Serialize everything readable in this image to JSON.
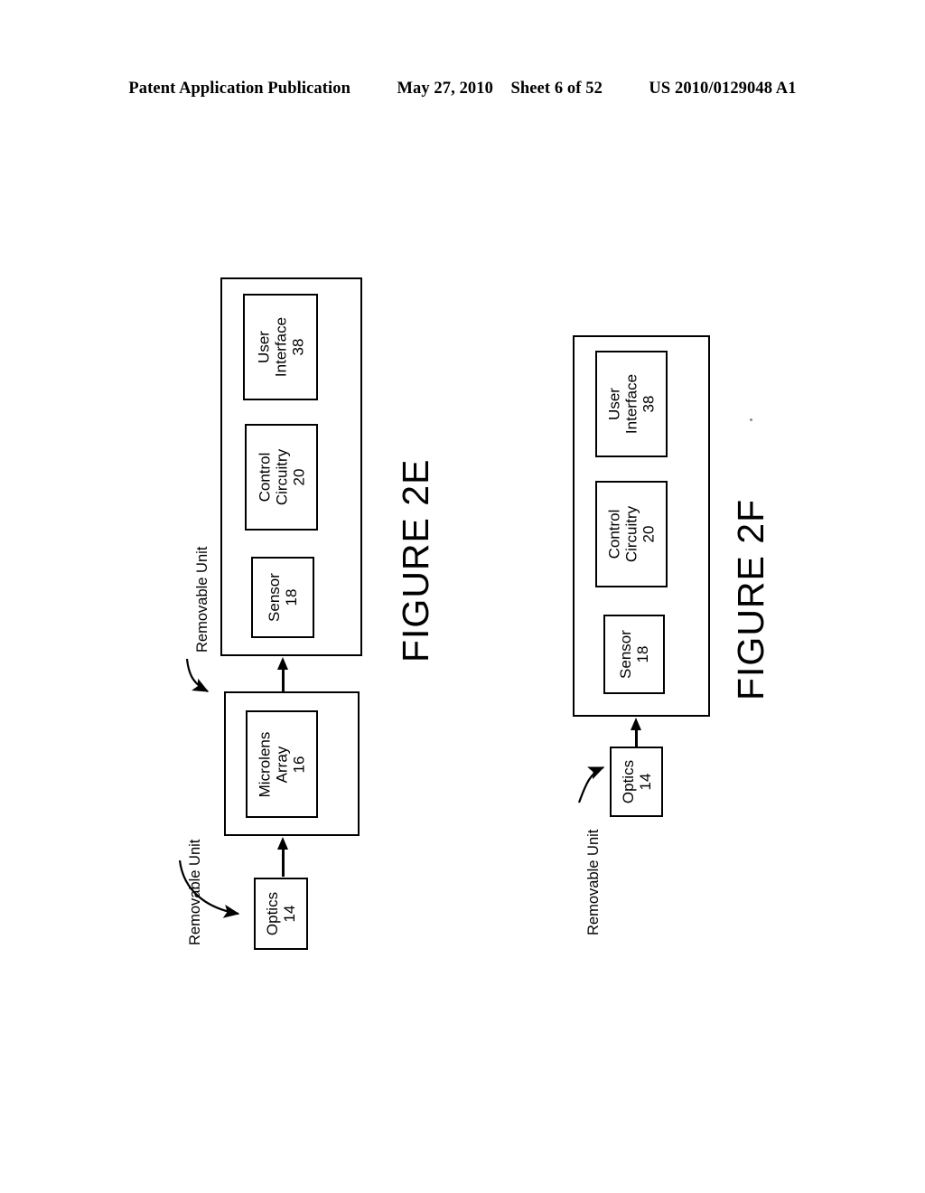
{
  "header": {
    "publication": "Patent Application Publication",
    "date": "May 27, 2010",
    "sheet": "Sheet 6 of 52",
    "doc_number": "US 2010/0129048 A1"
  },
  "figures": [
    {
      "id": "2E",
      "caption": "FIGURE 2E",
      "callouts": [
        {
          "text": "Removable Unit",
          "points_to": "main-unit-2e"
        },
        {
          "text": "Removable Unit",
          "points_to": "optics-14-2e"
        }
      ],
      "blocks": [
        {
          "id": "main-unit-2e",
          "kind": "container",
          "label": "",
          "number": ""
        },
        {
          "id": "user-interface-38-2e",
          "kind": "component",
          "label": "User\nInterface",
          "line1": "User",
          "line2": "Interface",
          "number": "38"
        },
        {
          "id": "control-circuitry-20-2e",
          "kind": "component",
          "line1": "Control",
          "line2": "Circuitry",
          "number": "20"
        },
        {
          "id": "sensor-18-2e",
          "kind": "component",
          "line1": "Sensor",
          "line2": "",
          "number": "18"
        },
        {
          "id": "microlens-unit-2e",
          "kind": "container",
          "label": "",
          "number": ""
        },
        {
          "id": "microlens-array-16-2e",
          "kind": "component",
          "line1": "Microlens",
          "line2": "Array",
          "number": "16"
        },
        {
          "id": "optics-14-2e",
          "kind": "component",
          "line1": "Optics",
          "line2": "",
          "number": "14"
        }
      ],
      "arrows": [
        {
          "from": "optics-14-2e",
          "to": "microlens-unit-2e"
        },
        {
          "from": "microlens-unit-2e",
          "to": "main-unit-2e"
        }
      ]
    },
    {
      "id": "2F",
      "caption": "FIGURE 2F",
      "callouts": [
        {
          "text": "Removable Unit",
          "points_to": "optics-14-2f"
        }
      ],
      "blocks": [
        {
          "id": "main-unit-2f",
          "kind": "container",
          "label": "",
          "number": ""
        },
        {
          "id": "user-interface-38-2f",
          "kind": "component",
          "line1": "User",
          "line2": "Interface",
          "number": "38"
        },
        {
          "id": "control-circuitry-20-2f",
          "kind": "component",
          "line1": "Control",
          "line2": "Circuitry",
          "number": "20"
        },
        {
          "id": "sensor-18-2f",
          "kind": "component",
          "line1": "Sensor",
          "line2": "",
          "number": "18"
        },
        {
          "id": "optics-14-2f",
          "kind": "component",
          "line1": "Optics",
          "line2": "",
          "number": "14"
        }
      ],
      "arrows": [
        {
          "from": "optics-14-2f",
          "to": "main-unit-2f"
        }
      ]
    }
  ],
  "labels": {
    "user_interface": "User",
    "user_interface_2": "Interface",
    "user_interface_num": "38",
    "control": "Control",
    "circuitry": "Circuitry",
    "control_num": "20",
    "sensor": "Sensor",
    "sensor_num": "18",
    "microlens": "Microlens",
    "array": "Array",
    "microlens_num": "16",
    "optics": "Optics",
    "optics_num": "14",
    "removable_unit": "Removable Unit",
    "figure_2e": "FIGURE 2E",
    "figure_2f": "FIGURE 2F"
  },
  "colors": {
    "ink": "#000000",
    "paper": "#ffffff"
  }
}
